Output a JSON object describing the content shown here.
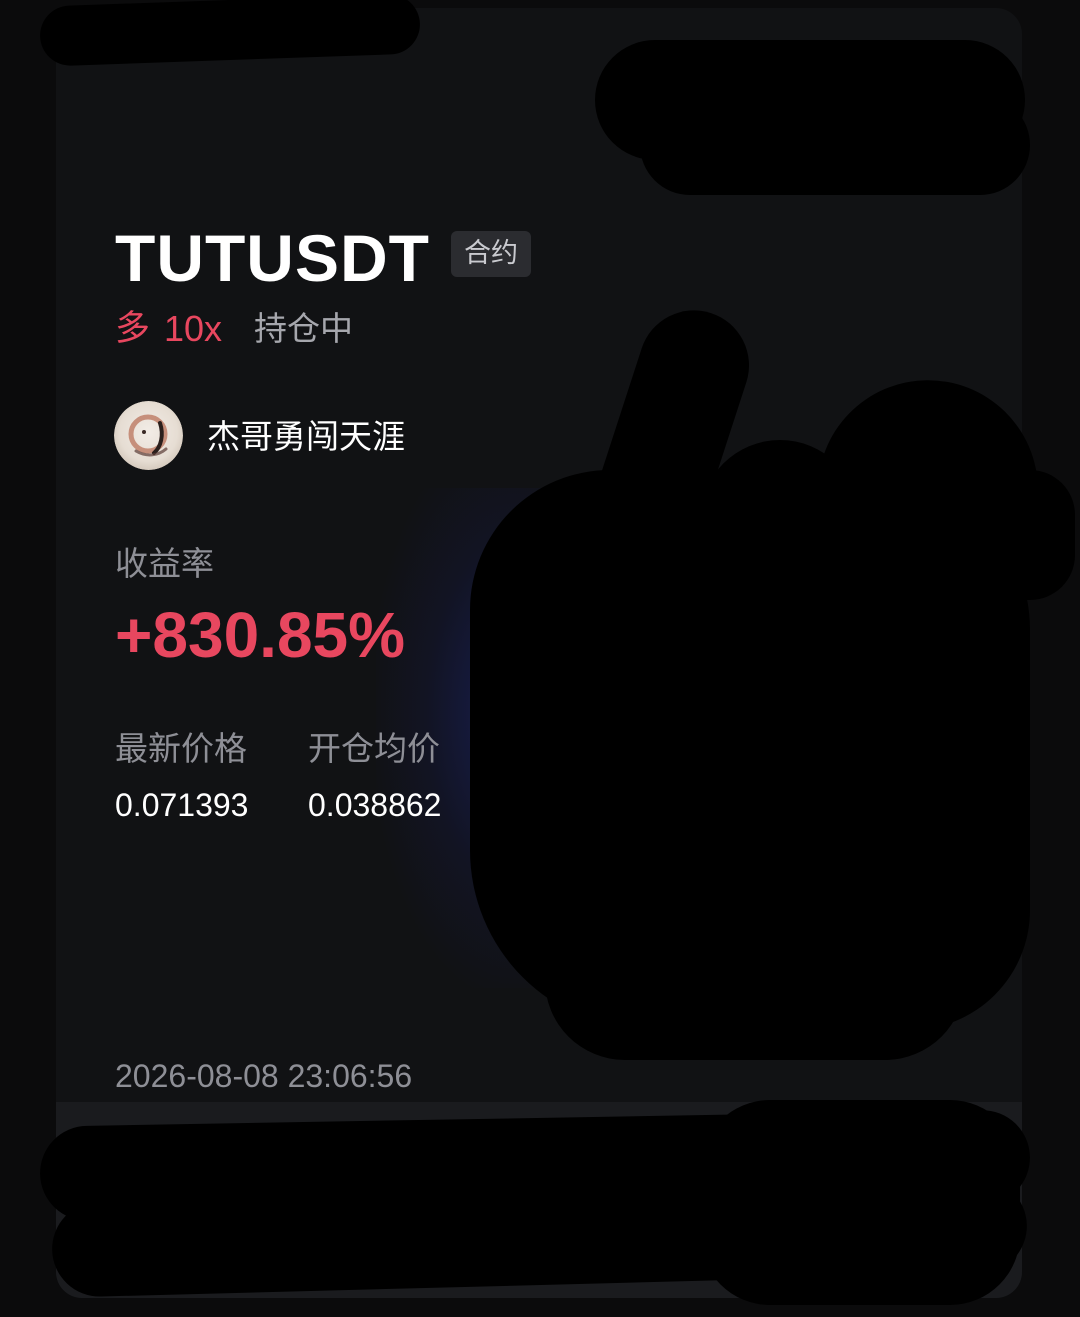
{
  "position": {
    "symbol": "TUTUSDT",
    "contract_badge": "合约",
    "direction": "多",
    "leverage": "10x",
    "status": "持仓中"
  },
  "trader": {
    "name": "杰哥勇闯天涯"
  },
  "roi": {
    "label": "收益率",
    "value": "+830.85%"
  },
  "prices": {
    "latest_label": "最新价格",
    "latest_value": "0.071393",
    "open_avg_label": "开仓均价",
    "open_avg_value": "0.038862"
  },
  "timestamp": "2026-08-08 23:06:56",
  "colors": {
    "profit_red": "#e8475f",
    "background": "#111214",
    "muted_text": "#8e8f96"
  }
}
